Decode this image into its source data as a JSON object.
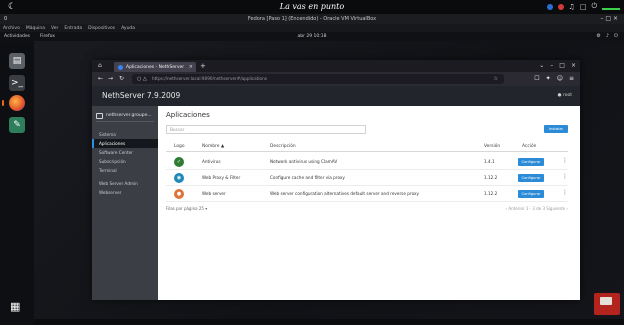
{
  "host": {
    "title": "La vas en punto",
    "menu_icon": "moon-icon",
    "tray_icons": [
      "record-dot",
      "network-dot",
      "audio-icon",
      "battery-icon",
      "power-icon"
    ]
  },
  "vm_window": {
    "left_label": "0",
    "subtitle": "Fedora [Paso 1] (Encendido) - Oracle VM VirtualBox",
    "controls": "– □ ×",
    "menu": [
      "Archivo",
      "Máquina",
      "Ver",
      "Entrada",
      "Dispositivos",
      "Ayuda"
    ]
  },
  "guest_panel": {
    "activities": "Actividades",
    "app_name": "Firefox",
    "clock": "abr 29  10:18"
  },
  "browser": {
    "tab_title": "Aplicaciones - NethServer",
    "url": "https://nethserver.local:9090/nethserver#/applications",
    "nav": {
      "back": "←",
      "forward": "→",
      "reload": "↻"
    }
  },
  "app": {
    "brand": "NethServer 7.9.2009",
    "user_label": "root",
    "sidebar": {
      "host": "nethserver.groupe...",
      "items": [
        {
          "label": "Sistema",
          "active": false
        },
        {
          "label": "Aplicaciones",
          "active": true
        },
        {
          "label": "Software Center",
          "active": false
        },
        {
          "label": "Subscripción",
          "active": false
        },
        {
          "label": "Terminal",
          "active": false
        },
        {
          "label": "Web Server Admin",
          "active": false
        },
        {
          "label": "Webserver",
          "active": false
        }
      ]
    },
    "page_title": "Aplicaciones",
    "search_placeholder": "Buscar",
    "add_button": "Instalar",
    "columns": [
      "Logo",
      "Nombre",
      "Descripción",
      "Versión",
      "Acción"
    ],
    "rows": [
      {
        "name": "Antivirus",
        "description": "Network antivirus using ClamAV",
        "version": "1.4.1",
        "action": "Configurar",
        "logo_color": "#2e7d32",
        "logo_icon": "shield-icon"
      },
      {
        "name": "Web Proxy & Filter",
        "description": "Configure cache and filter via proxy",
        "version": "1.12.2",
        "action": "Configurar",
        "logo_color": "#1e88b8",
        "logo_icon": "globe-icon"
      },
      {
        "name": "Web server",
        "description": "Web server configuration alternatives default server and reverse proxy",
        "version": "1.12.2",
        "action": "Configurar",
        "logo_color": "#e0733a",
        "logo_icon": "server-icon"
      }
    ],
    "pager": {
      "per_page_label": "Filas por página",
      "per_page_value": "25",
      "right": "‹ Anterior   1 - 3 de 3   Siguiente ›"
    }
  }
}
